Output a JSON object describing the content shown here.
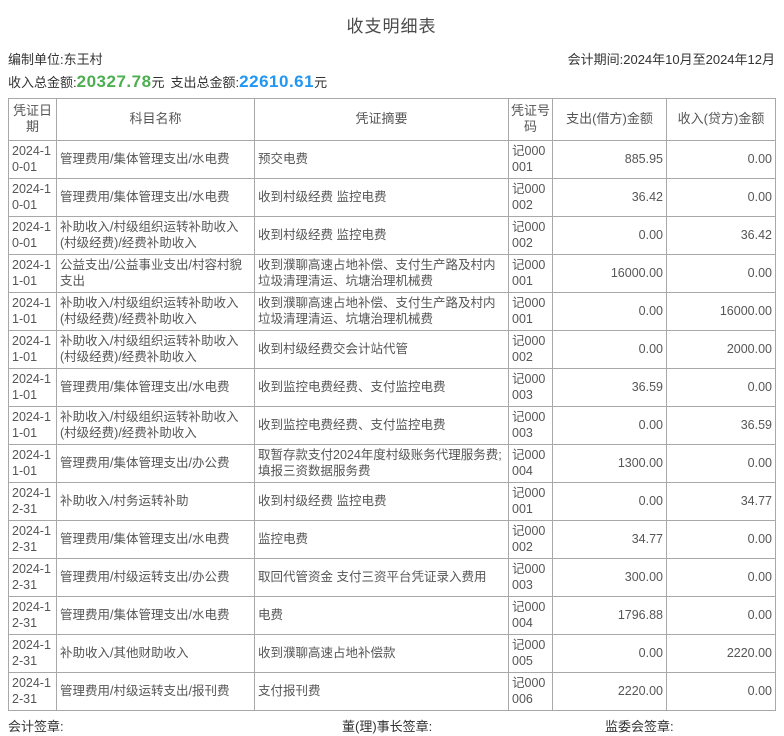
{
  "title": "收支明细表",
  "meta": {
    "unit": "编制单位:东王村",
    "period": "会计期间:2024年10月至2024年12月"
  },
  "totals": {
    "income_label": "收入总金额:",
    "income_value": "20327.78",
    "income_unit": "元",
    "expense_label": "支出总金额:",
    "expense_value": "22610.61",
    "expense_unit": "元"
  },
  "colors": {
    "income_total": "#4caf50",
    "expense_total": "#2196f3"
  },
  "table": {
    "columns": [
      "凭证日期",
      "科目名称",
      "凭证摘要",
      "凭证号码",
      "支出(借方)金额",
      "收入(贷方)金额"
    ],
    "rows": [
      {
        "date": "2024-10-01",
        "subject": "管理费用/集体管理支出/水电费",
        "summary": "预交电费",
        "voucher": "记000001",
        "debit": "885.95",
        "credit": "0.00"
      },
      {
        "date": "2024-10-01",
        "subject": "管理费用/集体管理支出/水电费",
        "summary": "收到村级经费 监控电费",
        "voucher": "记000002",
        "debit": "36.42",
        "credit": "0.00"
      },
      {
        "date": "2024-10-01",
        "subject": "补助收入/村级组织运转补助收入(村级经费)/经费补助收入",
        "summary": "收到村级经费 监控电费",
        "voucher": "记000002",
        "debit": "0.00",
        "credit": "36.42"
      },
      {
        "date": "2024-11-01",
        "subject": "公益支出/公益事业支出/村容村貌支出",
        "summary": "收到濮聊高速占地补偿、支付生产路及村内垃圾清理清运、坑塘治理机械费",
        "voucher": "记000001",
        "debit": "16000.00",
        "credit": "0.00"
      },
      {
        "date": "2024-11-01",
        "subject": "补助收入/村级组织运转补助收入(村级经费)/经费补助收入",
        "summary": "收到濮聊高速占地补偿、支付生产路及村内垃圾清理清运、坑塘治理机械费",
        "voucher": "记000001",
        "debit": "0.00",
        "credit": "16000.00"
      },
      {
        "date": "2024-11-01",
        "subject": "补助收入/村级组织运转补助收入(村级经费)/经费补助收入",
        "summary": "收到村级经费交会计站代管",
        "voucher": "记000002",
        "debit": "0.00",
        "credit": "2000.00"
      },
      {
        "date": "2024-11-01",
        "subject": "管理费用/集体管理支出/水电费",
        "summary": "收到监控电费经费、支付监控电费",
        "voucher": "记000003",
        "debit": "36.59",
        "credit": "0.00"
      },
      {
        "date": "2024-11-01",
        "subject": "补助收入/村级组织运转补助收入(村级经费)/经费补助收入",
        "summary": "收到监控电费经费、支付监控电费",
        "voucher": "记000003",
        "debit": "0.00",
        "credit": "36.59"
      },
      {
        "date": "2024-11-01",
        "subject": "管理费用/集体管理支出/办公费",
        "summary": "取暂存款支付2024年度村级账务代理服务费;填报三资数据服务费",
        "voucher": "记000004",
        "debit": "1300.00",
        "credit": "0.00"
      },
      {
        "date": "2024-12-31",
        "subject": "补助收入/村务运转补助",
        "summary": "收到村级经费 监控电费",
        "voucher": "记000001",
        "debit": "0.00",
        "credit": "34.77"
      },
      {
        "date": "2024-12-31",
        "subject": "管理费用/集体管理支出/水电费",
        "summary": "监控电费",
        "voucher": "记000002",
        "debit": "34.77",
        "credit": "0.00"
      },
      {
        "date": "2024-12-31",
        "subject": "管理费用/村级运转支出/办公费",
        "summary": "取回代管资金 支付三资平台凭证录入费用",
        "voucher": "记000003",
        "debit": "300.00",
        "credit": "0.00"
      },
      {
        "date": "2024-12-31",
        "subject": "管理费用/集体管理支出/水电费",
        "summary": "电费",
        "voucher": "记000004",
        "debit": "1796.88",
        "credit": "0.00"
      },
      {
        "date": "2024-12-31",
        "subject": "补助收入/其他财助收入",
        "summary": "收到濮聊高速占地补偿款",
        "voucher": "记000005",
        "debit": "0.00",
        "credit": "2220.00"
      },
      {
        "date": "2024-12-31",
        "subject": "管理费用/村级运转支出/报刊费",
        "summary": "支付报刊费",
        "voucher": "记000006",
        "debit": "2220.00",
        "credit": "0.00"
      }
    ]
  },
  "footer": {
    "accountant_sign": "会计签章:",
    "chairman_sign": "董(理)事长签章:",
    "committee_sign": "监委会签章:"
  }
}
